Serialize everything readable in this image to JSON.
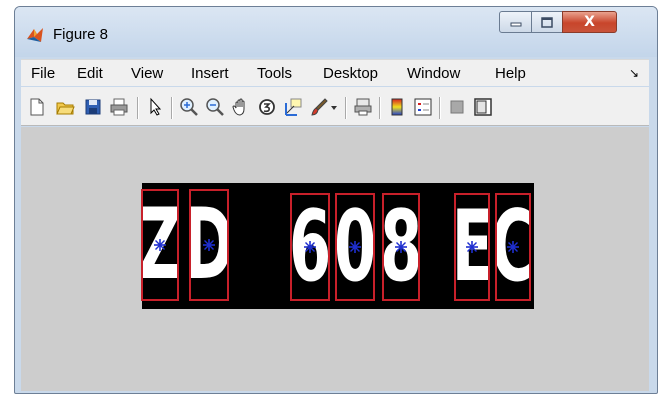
{
  "window": {
    "title": "Figure 8",
    "close_glyph": "X"
  },
  "menu": {
    "items": [
      "File",
      "Edit",
      "View",
      "Insert",
      "Tools",
      "Desktop",
      "Window",
      "Help"
    ],
    "overflow_glyph": "↘"
  },
  "toolbar": {
    "icons": [
      "new-figure-icon",
      "open-file-icon",
      "save-icon",
      "print-icon",
      "pointer-icon",
      "zoom-in-icon",
      "zoom-out-icon",
      "pan-icon",
      "rotate-3d-icon",
      "data-cursor-icon",
      "brush-icon",
      "brush-dropdown-icon",
      "link-plot-icon",
      "colorbar-icon",
      "legend-icon",
      "hide-plot-tools-icon",
      "show-plot-tools-icon"
    ]
  },
  "plate": {
    "characters": [
      "Z",
      "D",
      "6",
      "0",
      "8",
      "E",
      "C"
    ],
    "box_color": "#c8202a",
    "centroid_color": "#1f2fd0"
  },
  "colors": {
    "canvas": "#cdcdcd",
    "titlebar": "#c9d9eb",
    "close_button": "#c8452b"
  }
}
